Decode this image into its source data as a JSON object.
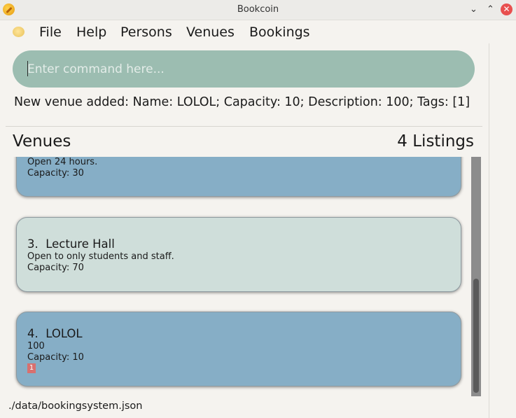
{
  "window": {
    "title": "Bookcoin",
    "minimize_glyph": "⌄",
    "maximize_glyph": "⌃",
    "close_glyph": "✕"
  },
  "menu": {
    "items": [
      "File",
      "Help",
      "Persons",
      "Venues",
      "Bookings"
    ]
  },
  "command": {
    "placeholder": "Enter command here...",
    "value": ""
  },
  "result": {
    "message": "New venue added: Name: LOLOL; Capacity: 10; Description: 100; Tags: [1]"
  },
  "panel": {
    "title": "Venues",
    "listing_count": "4 Listings"
  },
  "venues": [
    {
      "index_name": "",
      "description": "Open 24 hours.",
      "capacity": "Capacity: 30",
      "tags": []
    },
    {
      "index_name": "3.  Lecture Hall",
      "description": "Open to only students and staff.",
      "capacity": "Capacity: 70",
      "tags": []
    },
    {
      "index_name": "4.  LOLOL",
      "description": "100",
      "capacity": "Capacity: 10",
      "tags": [
        "1"
      ]
    }
  ],
  "status": {
    "file_path": "./data/bookingsystem.json"
  },
  "colors": {
    "command_bg": "#9cbdb1",
    "card_blue": "#86aec6",
    "card_pale": "#cfdeda",
    "tag_bg": "#d8706f",
    "close_button": "#e8504f"
  }
}
